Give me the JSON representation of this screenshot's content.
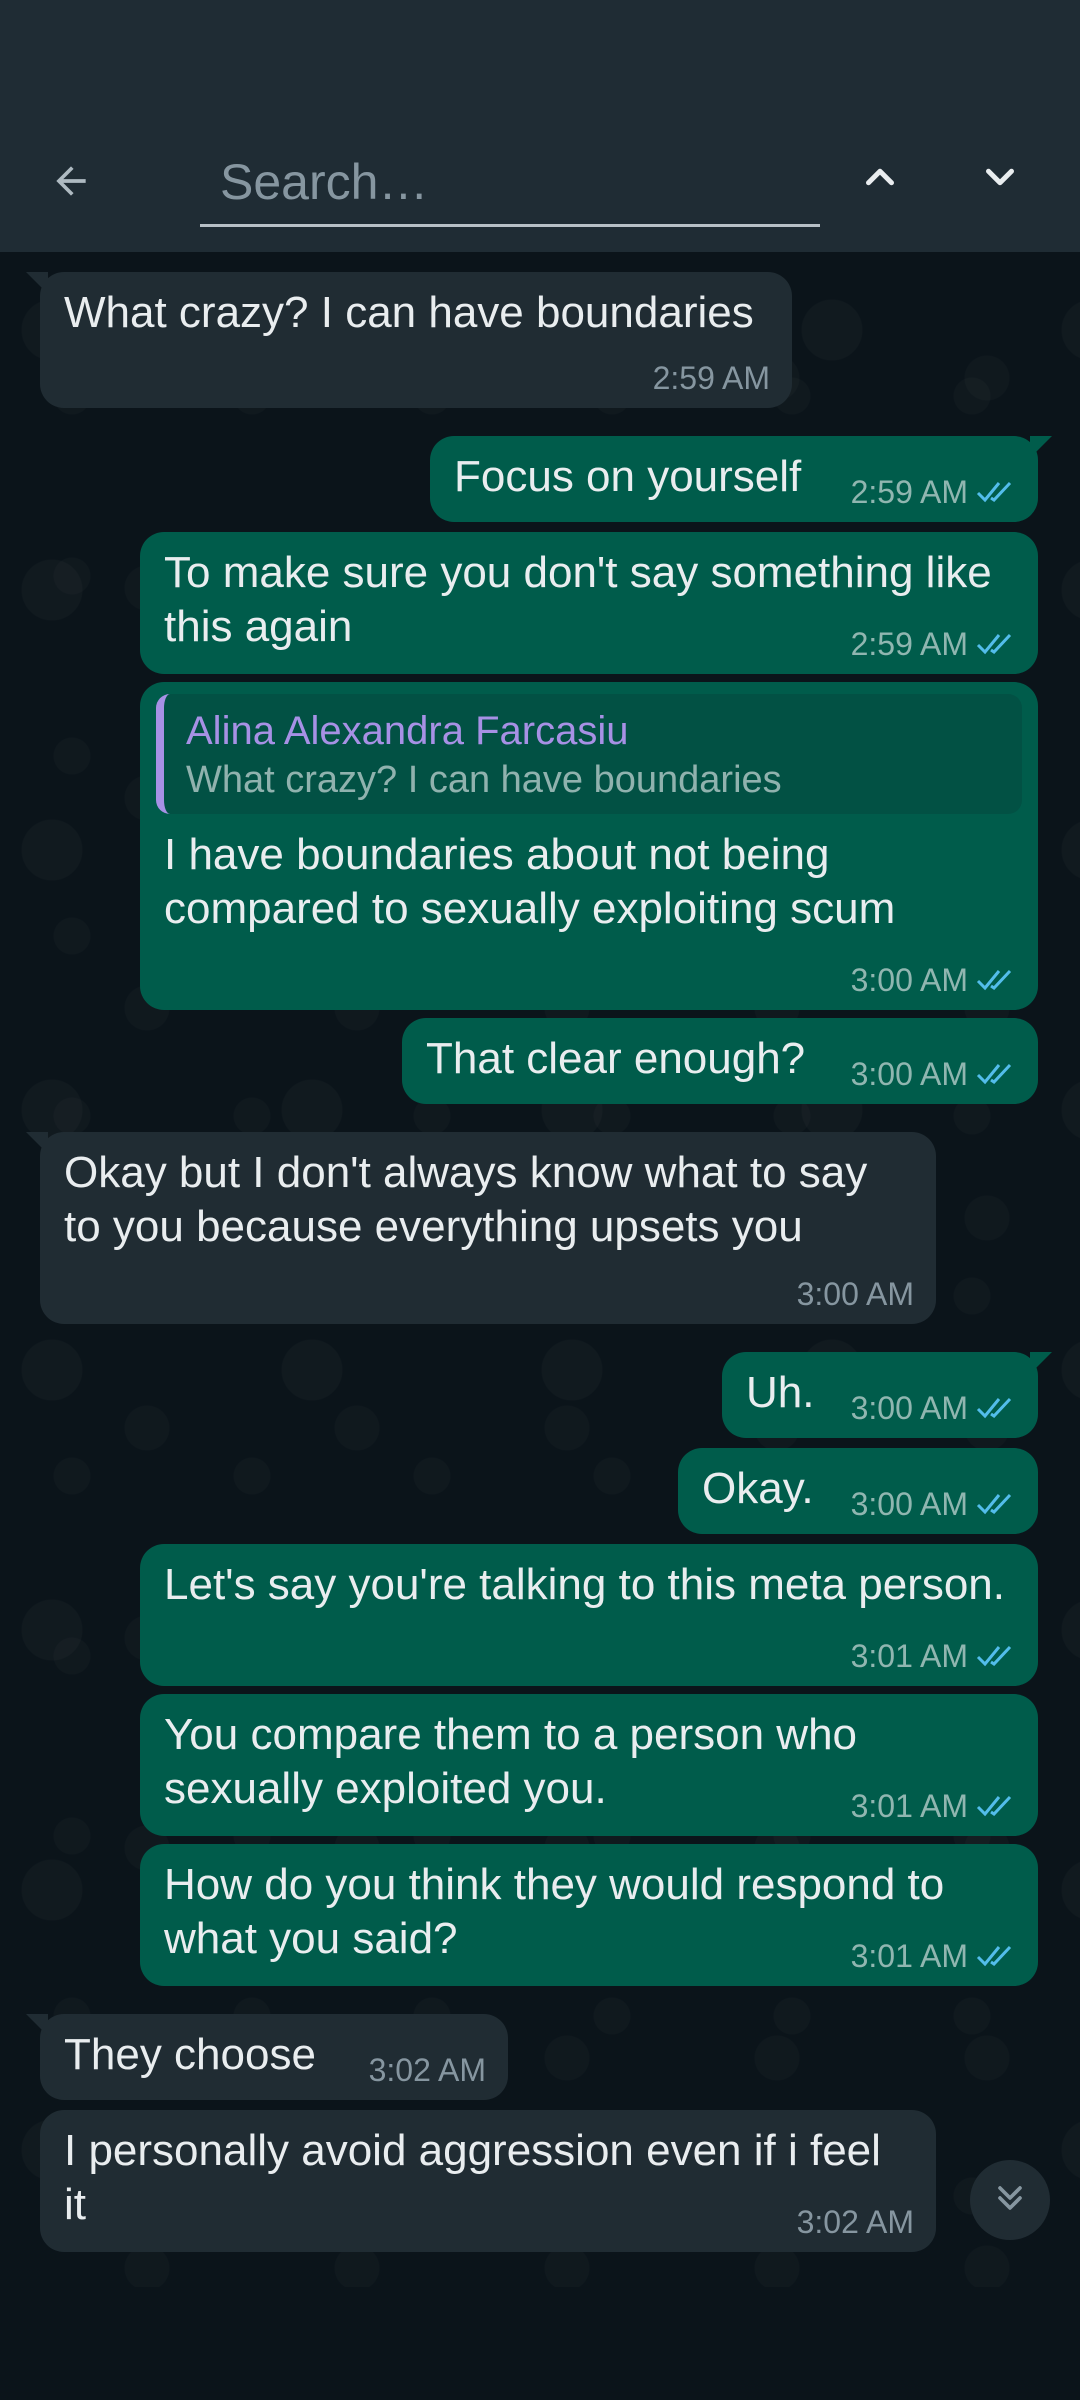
{
  "search": {
    "placeholder": "Search…"
  },
  "icons": {
    "back": "arrow-left-icon",
    "prev": "chevron-up-icon",
    "next": "chevron-down-icon",
    "read": "double-check-icon",
    "scroll": "double-chevron-down-icon"
  },
  "colors": {
    "header_bg": "#1f2c34",
    "chat_bg": "#0b141a",
    "incoming_bubble": "#202c33",
    "outgoing_bubble": "#005c4b",
    "read_tick": "#53bdeb",
    "quote_name": "#a791e5"
  },
  "messages": [
    {
      "dir": "in",
      "text": "What crazy? I can have boundaries",
      "time": "2:59 AM"
    },
    {
      "dir": "out",
      "text": "Focus on yourself",
      "time": "2:59 AM",
      "read": true
    },
    {
      "dir": "out",
      "text": "To make sure you don't say something like this again",
      "time": "2:59 AM",
      "read": true
    },
    {
      "dir": "out",
      "quote": {
        "name": "Alina Alexandra Farcasiu",
        "text": "What crazy? I can have boundaries"
      },
      "text": "I have boundaries about not being compared to sexually exploiting scum",
      "time": "3:00 AM",
      "read": true
    },
    {
      "dir": "out",
      "text": "That clear enough?",
      "time": "3:00 AM",
      "read": true
    },
    {
      "dir": "in",
      "text": "Okay but I don't always know what to say to you because everything upsets you",
      "time": "3:00 AM"
    },
    {
      "dir": "out",
      "text": "Uh.",
      "time": "3:00 AM",
      "read": true
    },
    {
      "dir": "out",
      "text": "Okay.",
      "time": "3:00 AM",
      "read": true
    },
    {
      "dir": "out",
      "text": "Let's say you're talking to this meta person.",
      "time": "3:01 AM",
      "read": true
    },
    {
      "dir": "out",
      "text": "You compare them to a person who sexually exploited you.",
      "time": "3:01 AM",
      "read": true
    },
    {
      "dir": "out",
      "text": "How do you think they would respond to what you said?",
      "time": "3:01 AM",
      "read": true
    },
    {
      "dir": "in",
      "text": "They choose",
      "time": "3:02 AM"
    },
    {
      "dir": "in",
      "text": "I personally avoid aggression even if i feel it",
      "time": "3:02 AM"
    }
  ]
}
